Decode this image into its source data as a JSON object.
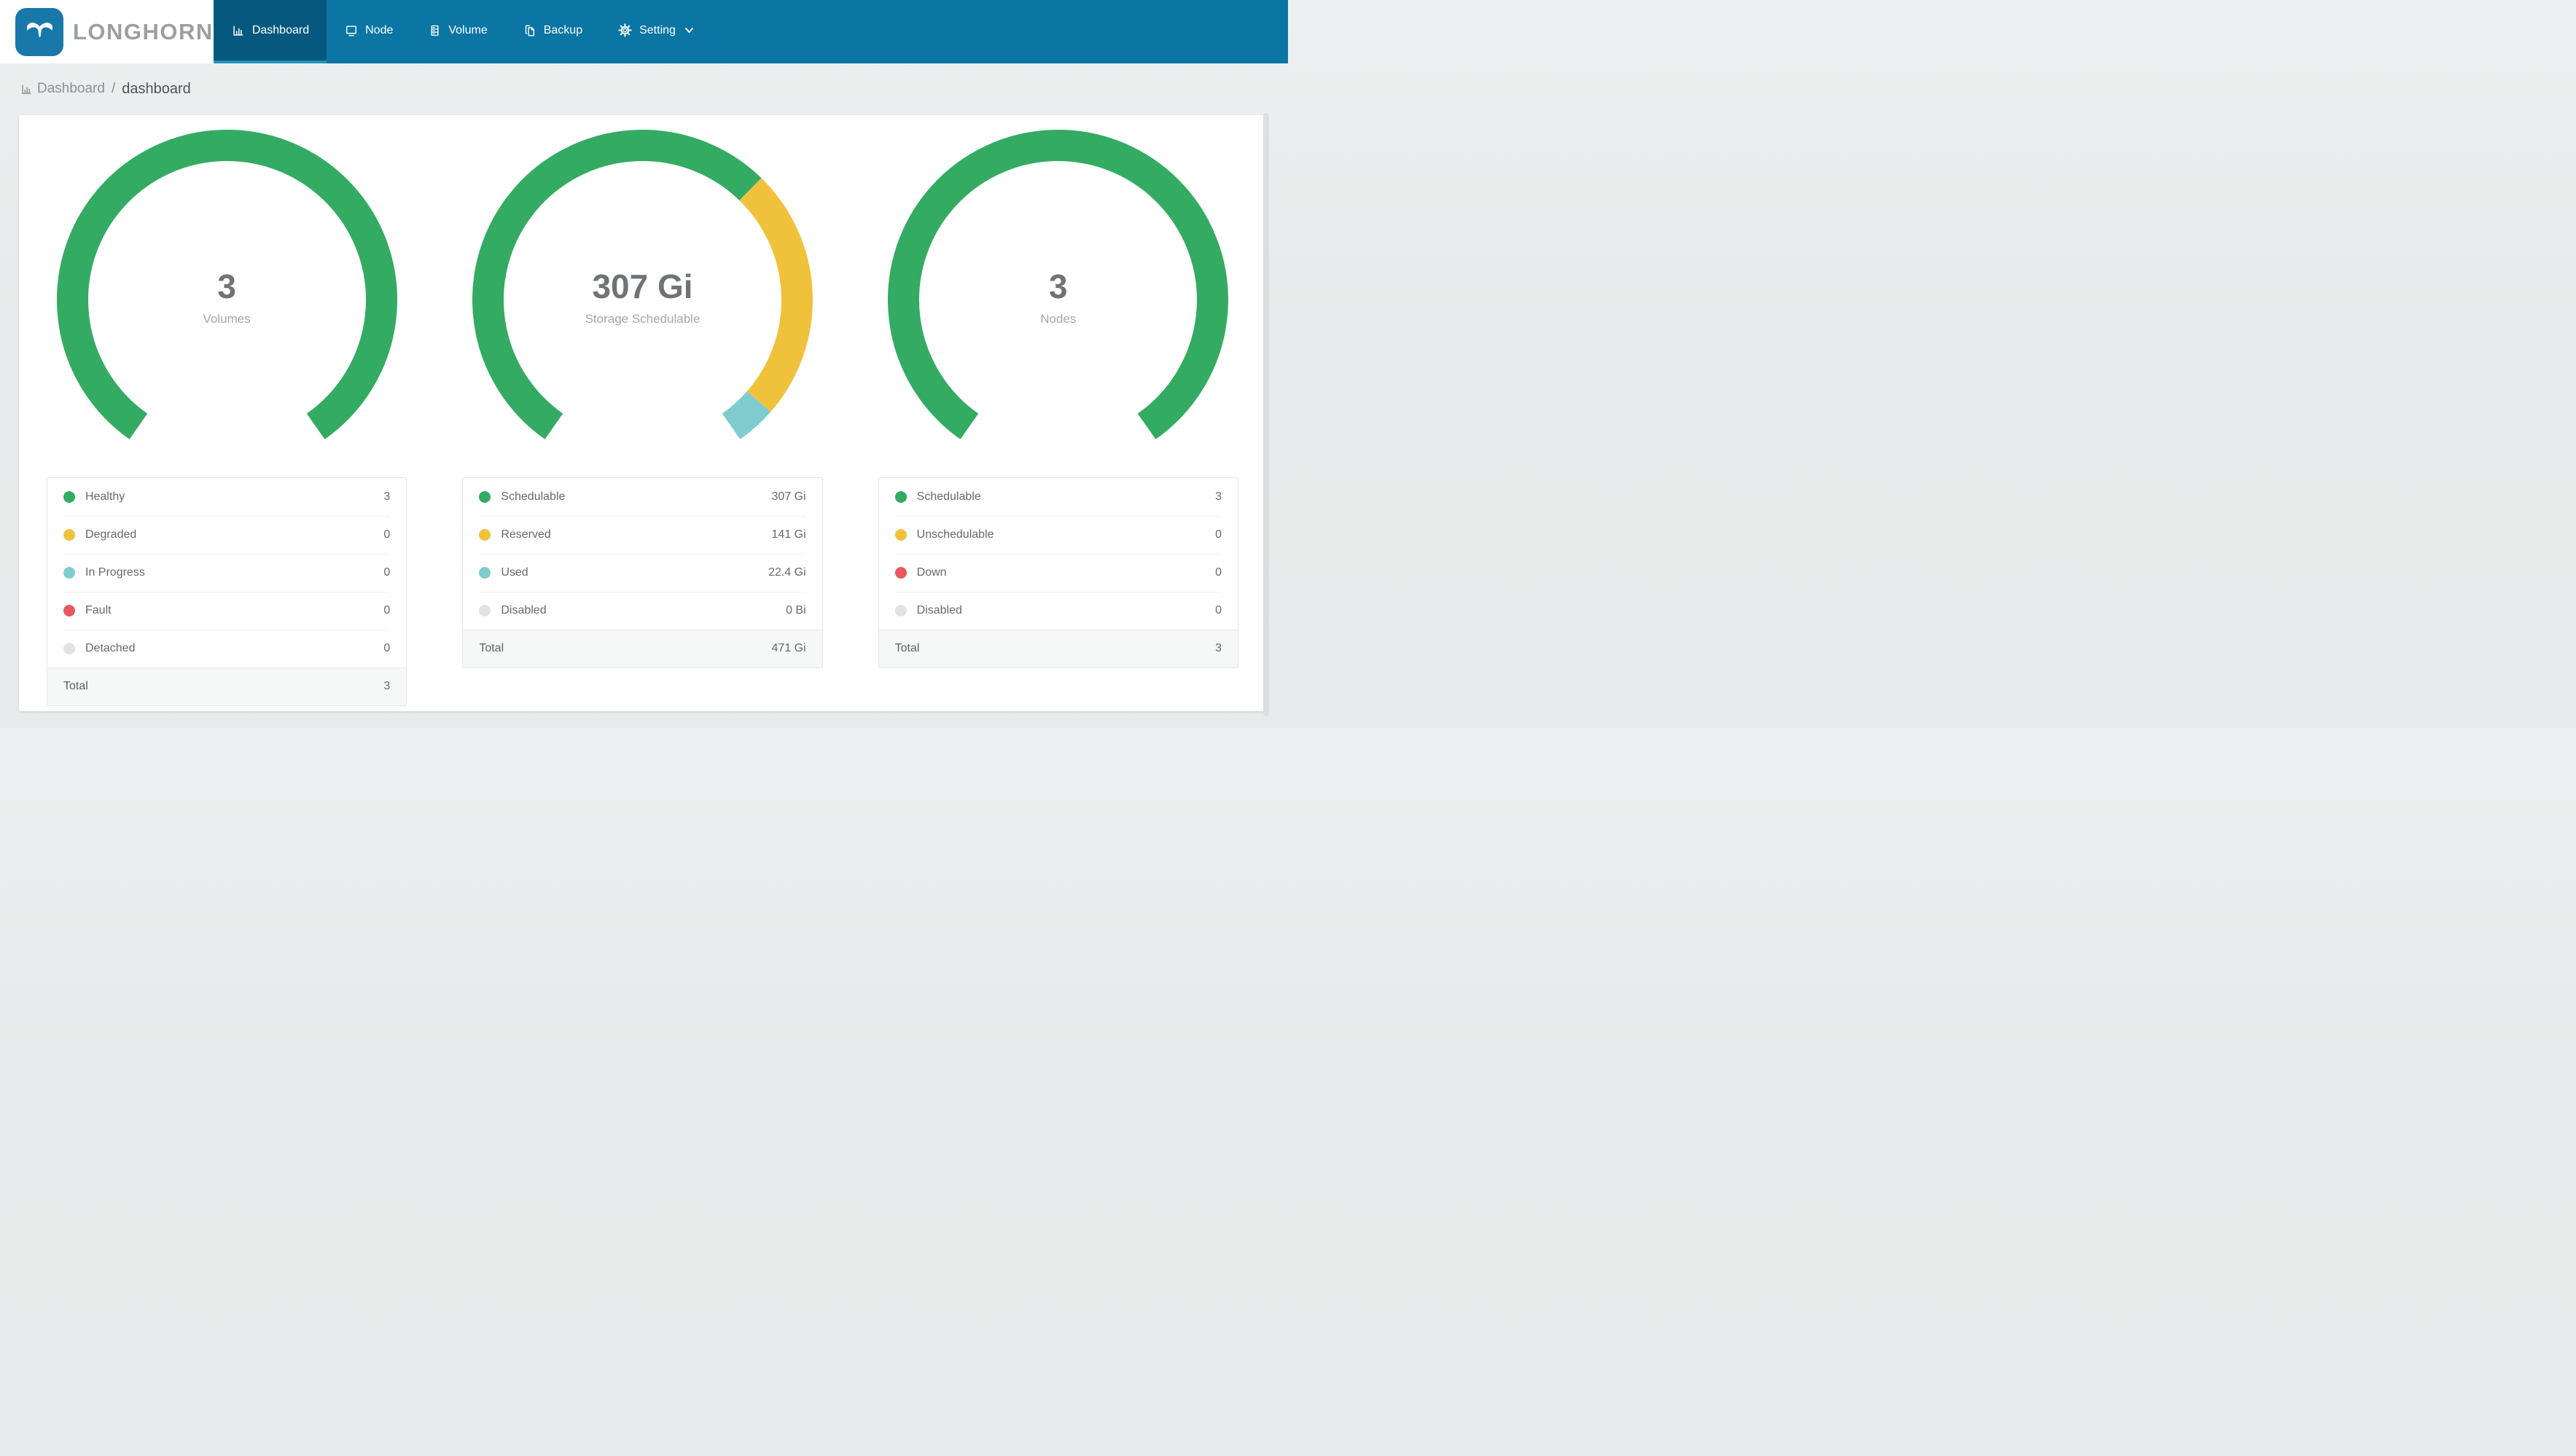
{
  "brand": {
    "name": "LONGHORN",
    "logo_icon": "bull-icon"
  },
  "nav": {
    "items": [
      {
        "label": "Dashboard",
        "icon": "dashboard-icon",
        "active": true
      },
      {
        "label": "Node",
        "icon": "node-icon",
        "active": false
      },
      {
        "label": "Volume",
        "icon": "volume-icon",
        "active": false
      },
      {
        "label": "Backup",
        "icon": "backup-icon",
        "active": false
      },
      {
        "label": "Setting",
        "icon": "gear-icon",
        "active": false,
        "dropdown": true
      }
    ]
  },
  "breadcrumb": {
    "icon": "chart-icon",
    "section": "Dashboard",
    "separator": "/",
    "page": "dashboard"
  },
  "colors": {
    "navbar": "#0b76a4",
    "navbar_active": "#07587e",
    "active_indicator": "#2193bd",
    "logo_blue": "#1878a9",
    "green": "#34ab62",
    "yellow": "#f0c23c",
    "teal": "#7fccce",
    "red": "#e9575f",
    "gray": "#e0e3e4"
  },
  "chart_data": [
    {
      "type": "pie",
      "variant": "gauge-donut",
      "center_value": "3",
      "center_label": "Volumes",
      "start_deg": 235,
      "span_deg": 290,
      "segments": [
        {
          "label": "Healthy",
          "value": 3,
          "display": "3",
          "color": "#34ab62"
        },
        {
          "label": "Degraded",
          "value": 0,
          "display": "0",
          "color": "#f0c23c"
        },
        {
          "label": "In Progress",
          "value": 0,
          "display": "0",
          "color": "#7fccce"
        },
        {
          "label": "Fault",
          "value": 0,
          "display": "0",
          "color": "#e9575f"
        },
        {
          "label": "Detached",
          "value": 0,
          "display": "0",
          "color": "#e0e3e4"
        }
      ],
      "total": {
        "label": "Total",
        "display": "3"
      }
    },
    {
      "type": "pie",
      "variant": "gauge-donut",
      "center_value": "307 Gi",
      "center_label": "Storage Schedulable",
      "start_deg": 235,
      "span_deg": 290,
      "segments": [
        {
          "label": "Schedulable",
          "value": 307,
          "display": "307 Gi",
          "color": "#34ab62"
        },
        {
          "label": "Reserved",
          "value": 141,
          "display": "141 Gi",
          "color": "#f0c23c"
        },
        {
          "label": "Used",
          "value": 22.4,
          "display": "22.4 Gi",
          "color": "#7fccce"
        },
        {
          "label": "Disabled",
          "value": 0,
          "display": "0 Bi",
          "color": "#e0e3e4"
        }
      ],
      "total": {
        "label": "Total",
        "display": "471 Gi"
      }
    },
    {
      "type": "pie",
      "variant": "gauge-donut",
      "center_value": "3",
      "center_label": "Nodes",
      "start_deg": 235,
      "span_deg": 290,
      "segments": [
        {
          "label": "Schedulable",
          "value": 3,
          "display": "3",
          "color": "#34ab62"
        },
        {
          "label": "Unschedulable",
          "value": 0,
          "display": "0",
          "color": "#f0c23c"
        },
        {
          "label": "Down",
          "value": 0,
          "display": "0",
          "color": "#e9575f"
        },
        {
          "label": "Disabled",
          "value": 0,
          "display": "0",
          "color": "#e0e3e4"
        }
      ],
      "total": {
        "label": "Total",
        "display": "3"
      }
    }
  ]
}
